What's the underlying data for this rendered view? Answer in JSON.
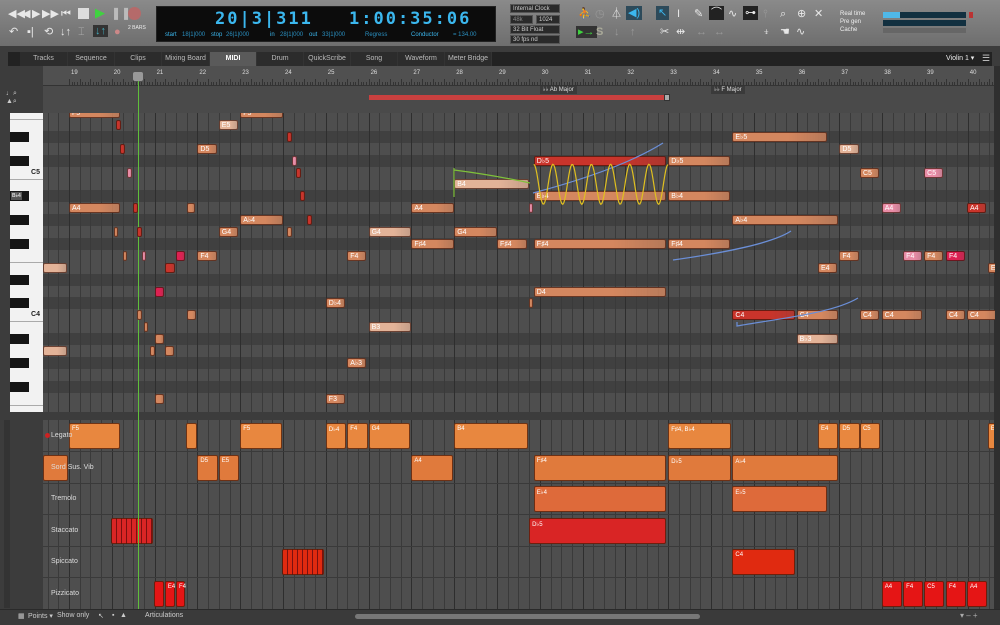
{
  "transport": {
    "buttons": [
      "rewind",
      "back",
      "forward",
      "fast-forward",
      "return-to-zero",
      "stop",
      "play",
      "pause",
      "record"
    ],
    "counter_bars": "20|3|311",
    "counter_time": "1:00:35:06",
    "start_label": "start",
    "start": "18|1|000",
    "stop_label": "stop",
    "stop": "26|1|000",
    "in_label": "in",
    "in": "28|1|000",
    "out_label": "out",
    "out": "33|1|000",
    "regress": "Regress",
    "conductor": "Conductor",
    "tempo": "= 134.00",
    "bars": "2 BARS"
  },
  "audio": {
    "clock": "Internal Clock",
    "rate": "48k",
    "buffer": "1024",
    "format": "32 Bit Float",
    "fps": "30 fps nd"
  },
  "meters": {
    "realtime": "Real time",
    "pregen": "Pre gen",
    "cache": "Cache",
    "realtime_level": 0.2
  },
  "tabs": [
    {
      "label": "Tracks"
    },
    {
      "label": "Sequence"
    },
    {
      "label": "Clips"
    },
    {
      "label": "Mixing Board"
    },
    {
      "label": "MIDI",
      "active": true
    },
    {
      "label": "Drum"
    },
    {
      "label": "QuickScribe"
    },
    {
      "label": "Song"
    },
    {
      "label": "Waveform"
    },
    {
      "label": "Meter Bridge"
    }
  ],
  "track_select": "Violin 1 ▾",
  "ruler": {
    "first": 19,
    "last": 40,
    "playhead": 20.6
  },
  "key_changes": [
    {
      "bar": 30,
      "label": "Ab Major"
    },
    {
      "bar": 34,
      "label": "F Major"
    }
  ],
  "conductor_region": {
    "start": 26,
    "end": 32.9
  },
  "keyboard_labels": [
    {
      "pitch": 72,
      "label": "C5"
    },
    {
      "pitch": 70,
      "label": "B♭4"
    },
    {
      "pitch": 60,
      "label": "C4"
    }
  ],
  "colors": {
    "note": "#d4875f",
    "light": "#e3b398",
    "red": "#c9342b",
    "pink": "#e88ca6",
    "hot": "#dd2152",
    "legato": "#e8873f",
    "sord": "#e07a3c",
    "tremolo": "#de6a3a",
    "staccato": "#d92525",
    "spiccato": "#e02a10",
    "pizz": "#e51515"
  },
  "notes": [
    {
      "p": 77,
      "s": 19,
      "l": 1.2,
      "t": "F5",
      "c": "note"
    },
    {
      "p": 77,
      "s": 23,
      "l": 1,
      "t": "F5",
      "c": "note"
    },
    {
      "p": 76,
      "s": 22.5,
      "l": 0.45,
      "t": "E5",
      "c": "light"
    },
    {
      "p": 74,
      "s": 22,
      "l": 0.45,
      "t": "D5",
      "c": "note"
    },
    {
      "p": 76,
      "s": 20.1,
      "l": 0.12,
      "t": "",
      "c": "red"
    },
    {
      "p": 74,
      "s": 20.2,
      "l": 0.12,
      "t": "",
      "c": "red"
    },
    {
      "p": 72,
      "s": 20.35,
      "l": 0.12,
      "t": "",
      "c": "pink"
    },
    {
      "p": 75,
      "s": 24.1,
      "l": 0.12,
      "t": "",
      "c": "red"
    },
    {
      "p": 73,
      "s": 24.2,
      "l": 0.12,
      "t": "",
      "c": "pink"
    },
    {
      "p": 72,
      "s": 24.3,
      "l": 0.12,
      "t": "",
      "c": "red"
    },
    {
      "p": 70,
      "s": 24.4,
      "l": 0.12,
      "t": "",
      "c": "red"
    },
    {
      "p": 68,
      "s": 24.55,
      "l": 0.12,
      "t": "",
      "c": "red"
    },
    {
      "p": 69,
      "s": 19,
      "l": 1.2,
      "t": "A4",
      "c": "note"
    },
    {
      "p": 69,
      "s": 20.5,
      "l": 0.12,
      "t": "",
      "c": "red"
    },
    {
      "p": 69,
      "s": 21.75,
      "l": 0.2,
      "t": "",
      "c": "note"
    },
    {
      "p": 68,
      "s": 23,
      "l": 1,
      "t": "A♭4",
      "c": "note"
    },
    {
      "p": 67,
      "s": 22.5,
      "l": 0.45,
      "t": "G4",
      "c": "note"
    },
    {
      "p": 67,
      "s": 20.05,
      "l": 0.1,
      "t": "",
      "c": "note"
    },
    {
      "p": 67,
      "s": 20.6,
      "l": 0.1,
      "t": "",
      "c": "red"
    },
    {
      "p": 67,
      "s": 24.1,
      "l": 0.1,
      "t": "",
      "c": "note"
    },
    {
      "p": 67,
      "s": 26,
      "l": 1,
      "t": "G4",
      "c": "light"
    },
    {
      "p": 69,
      "s": 27,
      "l": 1,
      "t": "A4",
      "c": "note"
    },
    {
      "p": 71,
      "s": 28,
      "l": 1.75,
      "t": "B4",
      "c": "light"
    },
    {
      "p": 67,
      "s": 28,
      "l": 1,
      "t": "G4",
      "c": "note"
    },
    {
      "p": 66,
      "s": 27,
      "l": 1,
      "t": "F♯4",
      "c": "note"
    },
    {
      "p": 66,
      "s": 29,
      "l": 0.7,
      "t": "F♯4",
      "c": "note"
    },
    {
      "p": 65,
      "s": 22,
      "l": 0.45,
      "t": "F4",
      "c": "note"
    },
    {
      "p": 65,
      "s": 25.5,
      "l": 0.45,
      "t": "F4",
      "c": "note"
    },
    {
      "p": 65,
      "s": 21.5,
      "l": 0.22,
      "t": "",
      "c": "hot"
    },
    {
      "p": 64,
      "s": 21.25,
      "l": 0.22,
      "t": "",
      "c": "red"
    },
    {
      "p": 62,
      "s": 21,
      "l": 0.22,
      "t": "",
      "c": "hot"
    },
    {
      "p": 65,
      "s": 20.25,
      "l": 0.1,
      "t": "",
      "c": "note"
    },
    {
      "p": 65,
      "s": 20.7,
      "l": 0.1,
      "t": "",
      "c": "pink"
    },
    {
      "p": 64,
      "s": 18.4,
      "l": 0.55,
      "t": "",
      "c": "light"
    },
    {
      "p": 57,
      "s": 18.4,
      "l": 0.55,
      "t": "",
      "c": "light"
    },
    {
      "p": 61,
      "s": 25,
      "l": 0.45,
      "t": "D♭4",
      "c": "note"
    },
    {
      "p": 59,
      "s": 26,
      "l": 1,
      "t": "B3",
      "c": "light"
    },
    {
      "p": 56,
      "s": 25.5,
      "l": 0.45,
      "t": "A♭3",
      "c": "note"
    },
    {
      "p": 53,
      "s": 25,
      "l": 0.45,
      "t": "F3",
      "c": "note"
    },
    {
      "p": 60,
      "s": 21.75,
      "l": 0.22,
      "t": "",
      "c": "note"
    },
    {
      "p": 58,
      "s": 21,
      "l": 0.22,
      "t": "",
      "c": "note"
    },
    {
      "p": 57,
      "s": 21.25,
      "l": 0.2,
      "t": "",
      "c": "note"
    },
    {
      "p": 53,
      "s": 21,
      "l": 0.22,
      "t": "",
      "c": "note"
    },
    {
      "p": 60,
      "s": 20.6,
      "l": 0.1,
      "t": "",
      "c": "note"
    },
    {
      "p": 59,
      "s": 20.75,
      "l": 0.1,
      "t": "",
      "c": "note"
    },
    {
      "p": 57,
      "s": 20.9,
      "l": 0.1,
      "t": "",
      "c": "note"
    },
    {
      "p": 73,
      "s": 29.86,
      "l": 3.1,
      "t": "D♭5",
      "c": "red"
    },
    {
      "p": 73,
      "s": 33,
      "l": 1.45,
      "t": "D♭5",
      "c": "note"
    },
    {
      "p": 70,
      "s": 29.86,
      "l": 3.1,
      "t": "B♭4",
      "c": "note"
    },
    {
      "p": 70,
      "s": 33,
      "l": 1.45,
      "t": "B♭4",
      "c": "note"
    },
    {
      "p": 66,
      "s": 29.86,
      "l": 3.1,
      "t": "F♯4",
      "c": "note"
    },
    {
      "p": 66,
      "s": 33,
      "l": 1.45,
      "t": "F♯4",
      "c": "note"
    },
    {
      "p": 69,
      "s": 29.75,
      "l": 0.1,
      "t": "",
      "c": "pink"
    },
    {
      "p": 75,
      "s": 34.5,
      "l": 2.2,
      "t": "E♭5",
      "c": "note"
    },
    {
      "p": 74,
      "s": 37,
      "l": 0.45,
      "t": "D5",
      "c": "light"
    },
    {
      "p": 72,
      "s": 37.48,
      "l": 0.45,
      "t": "C5",
      "c": "note"
    },
    {
      "p": 72,
      "s": 38.98,
      "l": 0.45,
      "t": "C5",
      "c": "pink"
    },
    {
      "p": 69,
      "s": 37.99,
      "l": 0.45,
      "t": "A4",
      "c": "pink"
    },
    {
      "p": 69,
      "s": 39.98,
      "l": 0.45,
      "t": "A4",
      "c": "red"
    },
    {
      "p": 68,
      "s": 34.5,
      "l": 2.47,
      "t": "A♭4",
      "c": "note"
    },
    {
      "p": 65,
      "s": 37,
      "l": 0.45,
      "t": "F4",
      "c": "note"
    },
    {
      "p": 65,
      "s": 38.49,
      "l": 0.45,
      "t": "F4",
      "c": "pink"
    },
    {
      "p": 65,
      "s": 38.98,
      "l": 0.45,
      "t": "F4",
      "c": "note"
    },
    {
      "p": 65,
      "s": 39.49,
      "l": 0.45,
      "t": "F4",
      "c": "hot"
    },
    {
      "p": 64,
      "s": 36.5,
      "l": 0.45,
      "t": "E4",
      "c": "note"
    },
    {
      "p": 64,
      "s": 40.47,
      "l": 0.3,
      "t": "E",
      "c": "note"
    },
    {
      "p": 62,
      "s": 29.86,
      "l": 3.1,
      "t": "D4",
      "c": "note"
    },
    {
      "p": 61,
      "s": 29.75,
      "l": 0.1,
      "t": "",
      "c": "note"
    },
    {
      "p": 60,
      "s": 34.5,
      "l": 1.47,
      "t": "C4",
      "c": "red"
    },
    {
      "p": 60,
      "s": 36,
      "l": 0.97,
      "t": "C4",
      "c": "note"
    },
    {
      "p": 60,
      "s": 37.48,
      "l": 0.45,
      "t": "C4",
      "c": "note"
    },
    {
      "p": 60,
      "s": 37.99,
      "l": 0.95,
      "t": "C4",
      "c": "note"
    },
    {
      "p": 60,
      "s": 39.49,
      "l": 0.45,
      "t": "C4",
      "c": "note"
    },
    {
      "p": 60,
      "s": 39.98,
      "l": 0.7,
      "t": "C4",
      "c": "note"
    },
    {
      "p": 58,
      "s": 36,
      "l": 0.97,
      "t": "B♭3",
      "c": "light"
    }
  ],
  "lanes": [
    {
      "name": "Legato",
      "marker": true,
      "color": "legato",
      "blocks": [
        {
          "s": 19,
          "l": 1.2,
          "t": "F5"
        },
        {
          "s": 21.73,
          "l": 0.25,
          "t": ""
        },
        {
          "s": 23,
          "l": 0.97,
          "t": "F5"
        },
        {
          "s": 25,
          "l": 0.48,
          "t": "D♭4"
        },
        {
          "s": 25.5,
          "l": 0.48,
          "t": "F4"
        },
        {
          "s": 26,
          "l": 0.97,
          "t": "G4"
        },
        {
          "s": 28,
          "l": 1.72,
          "t": "B4"
        },
        {
          "s": 33,
          "l": 1.47,
          "t": "F♯4, B♭4"
        },
        {
          "s": 36.5,
          "l": 0.47,
          "t": "E4"
        },
        {
          "s": 37,
          "l": 0.47,
          "t": "D5"
        },
        {
          "s": 37.48,
          "l": 0.47,
          "t": "C5"
        },
        {
          "s": 40.47,
          "l": 0.3,
          "t": "E"
        }
      ]
    },
    {
      "name": "Sord Sus. Vib",
      "color": "sord",
      "blocks": [
        {
          "s": 18.4,
          "l": 0.57,
          "t": ""
        },
        {
          "s": 22,
          "l": 0.48,
          "t": "D5"
        },
        {
          "s": 22.5,
          "l": 0.48,
          "t": "E5"
        },
        {
          "s": 27,
          "l": 0.97,
          "t": "A4"
        },
        {
          "s": 29.86,
          "l": 3.1,
          "t": "F♯4"
        },
        {
          "s": 33,
          "l": 1.47,
          "t": "D♭5"
        },
        {
          "s": 34.5,
          "l": 2.47,
          "t": "A♭4"
        }
      ]
    },
    {
      "name": "Tremolo",
      "color": "tremolo",
      "blocks": [
        {
          "s": 29.86,
          "l": 3.1,
          "t": "E♭4"
        },
        {
          "s": 34.5,
          "l": 2.22,
          "t": "E♭5"
        }
      ]
    },
    {
      "name": "Staccato",
      "color": "staccato",
      "blocks": [
        {
          "s": 19.98,
          "l": 0.98,
          "t": "",
          "striped": true
        },
        {
          "s": 29.75,
          "l": 3.2,
          "t": "D♭5"
        }
      ]
    },
    {
      "name": "Spiccato",
      "color": "spiccato",
      "blocks": [
        {
          "s": 23.98,
          "l": 0.98,
          "t": "",
          "striped": true
        },
        {
          "s": 34.5,
          "l": 1.47,
          "t": "C4"
        }
      ]
    },
    {
      "name": "Pizzicato",
      "color": "pizz",
      "blocks": [
        {
          "s": 20.99,
          "l": 0.24,
          "t": ""
        },
        {
          "s": 21.24,
          "l": 0.24,
          "t": "E4"
        },
        {
          "s": 21.5,
          "l": 0.22,
          "t": "F4"
        },
        {
          "s": 37.99,
          "l": 0.47,
          "t": "A4"
        },
        {
          "s": 38.49,
          "l": 0.47,
          "t": "F4"
        },
        {
          "s": 38.98,
          "l": 0.47,
          "t": "C5"
        },
        {
          "s": 39.49,
          "l": 0.47,
          "t": "F4"
        },
        {
          "s": 39.98,
          "l": 0.47,
          "t": "A4"
        }
      ]
    }
  ],
  "bottom": {
    "points": "Points ▾",
    "show_only": "Show only",
    "articulations": "Articulations"
  }
}
